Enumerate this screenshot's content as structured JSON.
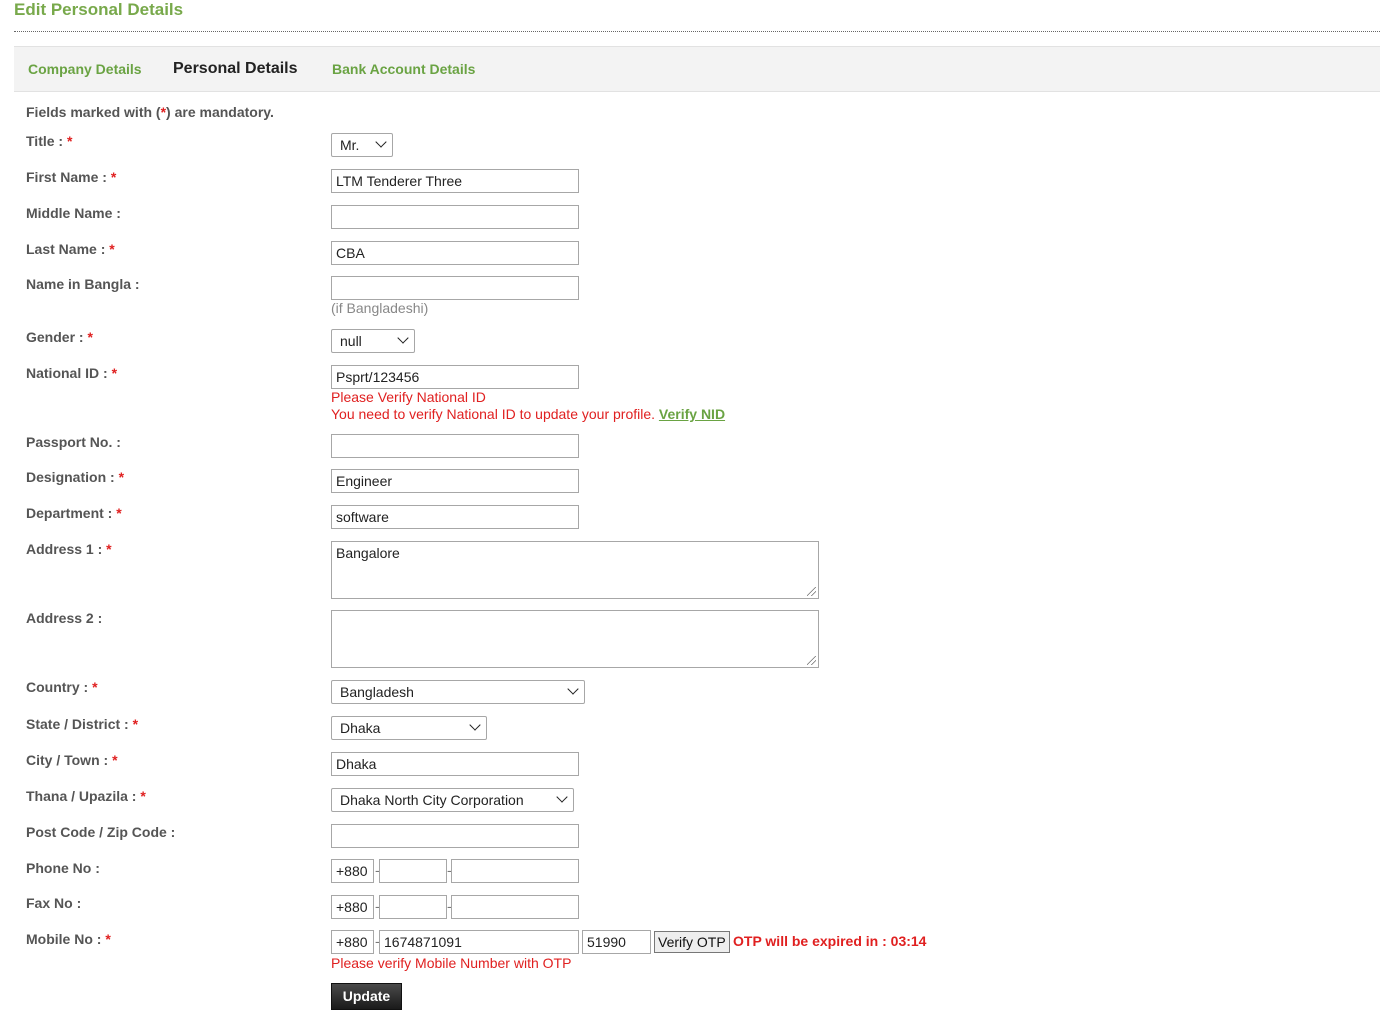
{
  "page": {
    "title": "Edit Personal Details"
  },
  "tabs": [
    {
      "label": "Company Details"
    },
    {
      "label": "Personal Details"
    },
    {
      "label": "Bank Account Details"
    }
  ],
  "mandatory_note": {
    "prefix": "Fields marked with (",
    "star": "*",
    "suffix": ") are mandatory."
  },
  "labels": {
    "title": "Title :",
    "first_name": "First Name :",
    "middle_name": "Middle Name :",
    "last_name": "Last Name :",
    "name_bangla": "Name in Bangla :",
    "gender": "Gender :",
    "national_id": "National ID :",
    "passport": "Passport No. :",
    "designation": "Designation :",
    "department": "Department :",
    "address1": "Address 1 :",
    "address2": "Address 2 :",
    "country": "Country :",
    "state": "State / District :",
    "city": "City / Town :",
    "thana": "Thana / Upazila :",
    "postcode": "Post Code / Zip Code :",
    "phone": "Phone No :",
    "fax": "Fax No :",
    "mobile": "Mobile No :"
  },
  "required_mark": "*",
  "values": {
    "title": "Mr.",
    "first_name": "LTM Tenderer Three",
    "middle_name": "",
    "last_name": "CBA",
    "name_bangla": "",
    "gender": "null",
    "national_id": "Psprt/123456",
    "passport": "",
    "designation": "Engineer",
    "department": "software",
    "address1": "Bangalore",
    "address2": "",
    "country": "Bangladesh",
    "state": "Dhaka",
    "city": "Dhaka",
    "thana": "Dhaka North City Corporation",
    "postcode": "",
    "phone_code": "+880",
    "phone_area": "",
    "phone_number": "",
    "fax_code": "+880",
    "fax_area": "",
    "fax_number": "",
    "mobile_code": "+880",
    "mobile_number": "1674871091",
    "otp": "51990"
  },
  "hints": {
    "name_bangla": "(if Bangladeshi)"
  },
  "messages": {
    "nid_verify": "Please Verify National ID",
    "nid_update": "You need to verify National ID to update your profile.",
    "nid_link": "Verify NID",
    "mobile_verify": "Please verify Mobile Number with OTP",
    "otp_expiry": "OTP will be expired in : 03:14"
  },
  "separator": "-",
  "buttons": {
    "verify_otp": "Verify OTP",
    "update": "Update"
  }
}
